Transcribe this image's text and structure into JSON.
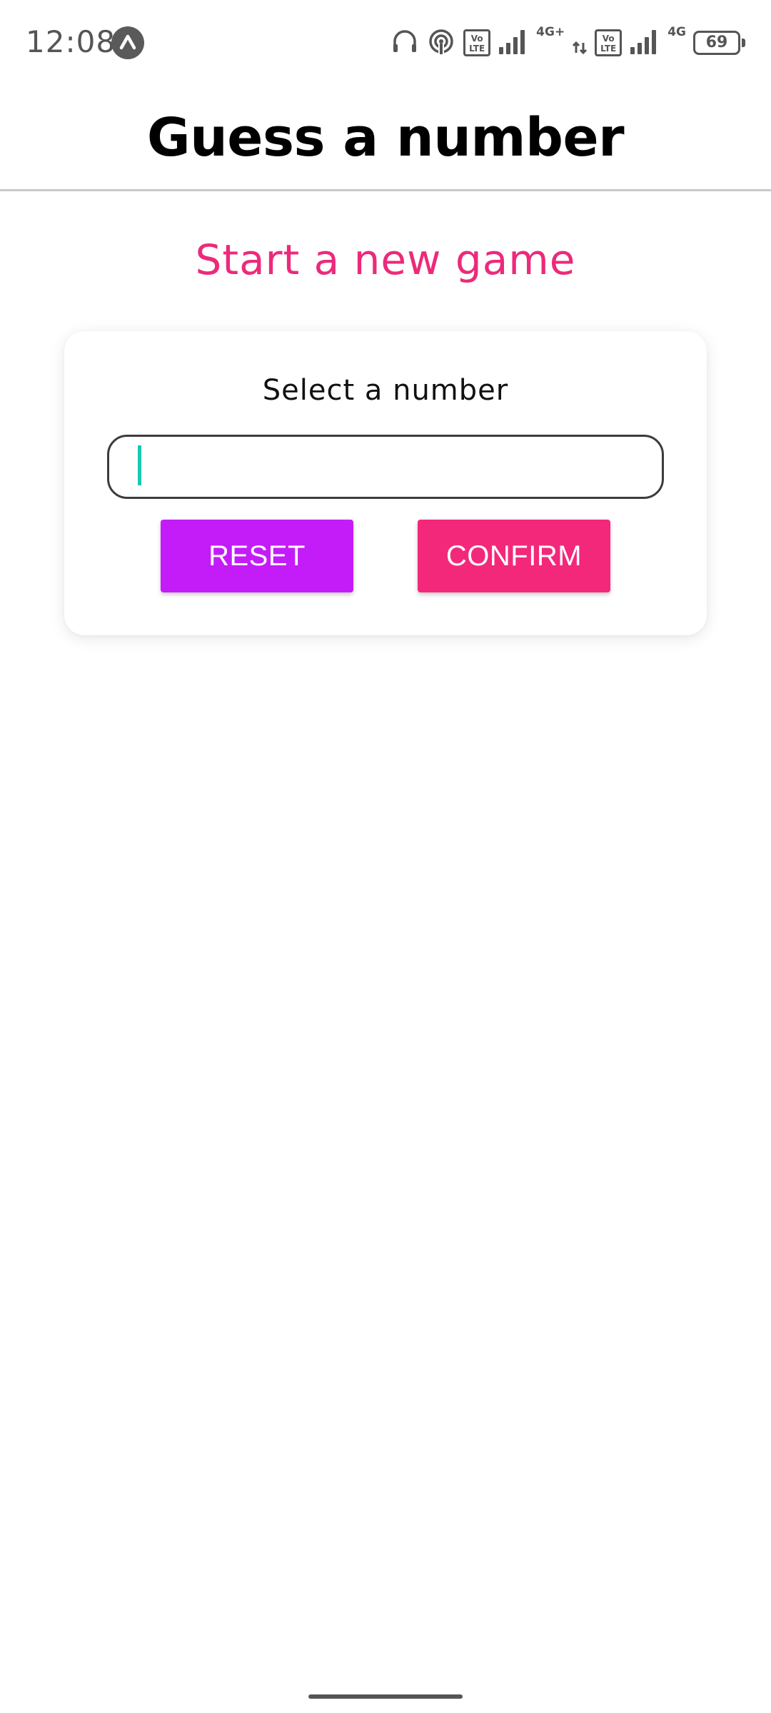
{
  "status_bar": {
    "time": "12:08",
    "notification_icon": "app-notification-icon",
    "network_1_label": "4G+",
    "network_2_label": "4G",
    "volte_label": "Vo\nLTE",
    "battery_level": "69"
  },
  "header": {
    "title": "Guess a number"
  },
  "main": {
    "screen_title": "Start a new game",
    "card": {
      "label": "Select a number",
      "input_value": "",
      "reset_label": "RESET",
      "confirm_label": "CONFIRM"
    }
  },
  "colors": {
    "accent_pink": "#ec2a7a",
    "reset_button": "#c41cf8",
    "confirm_button": "#f3287b",
    "caret": "#19c9b1"
  }
}
